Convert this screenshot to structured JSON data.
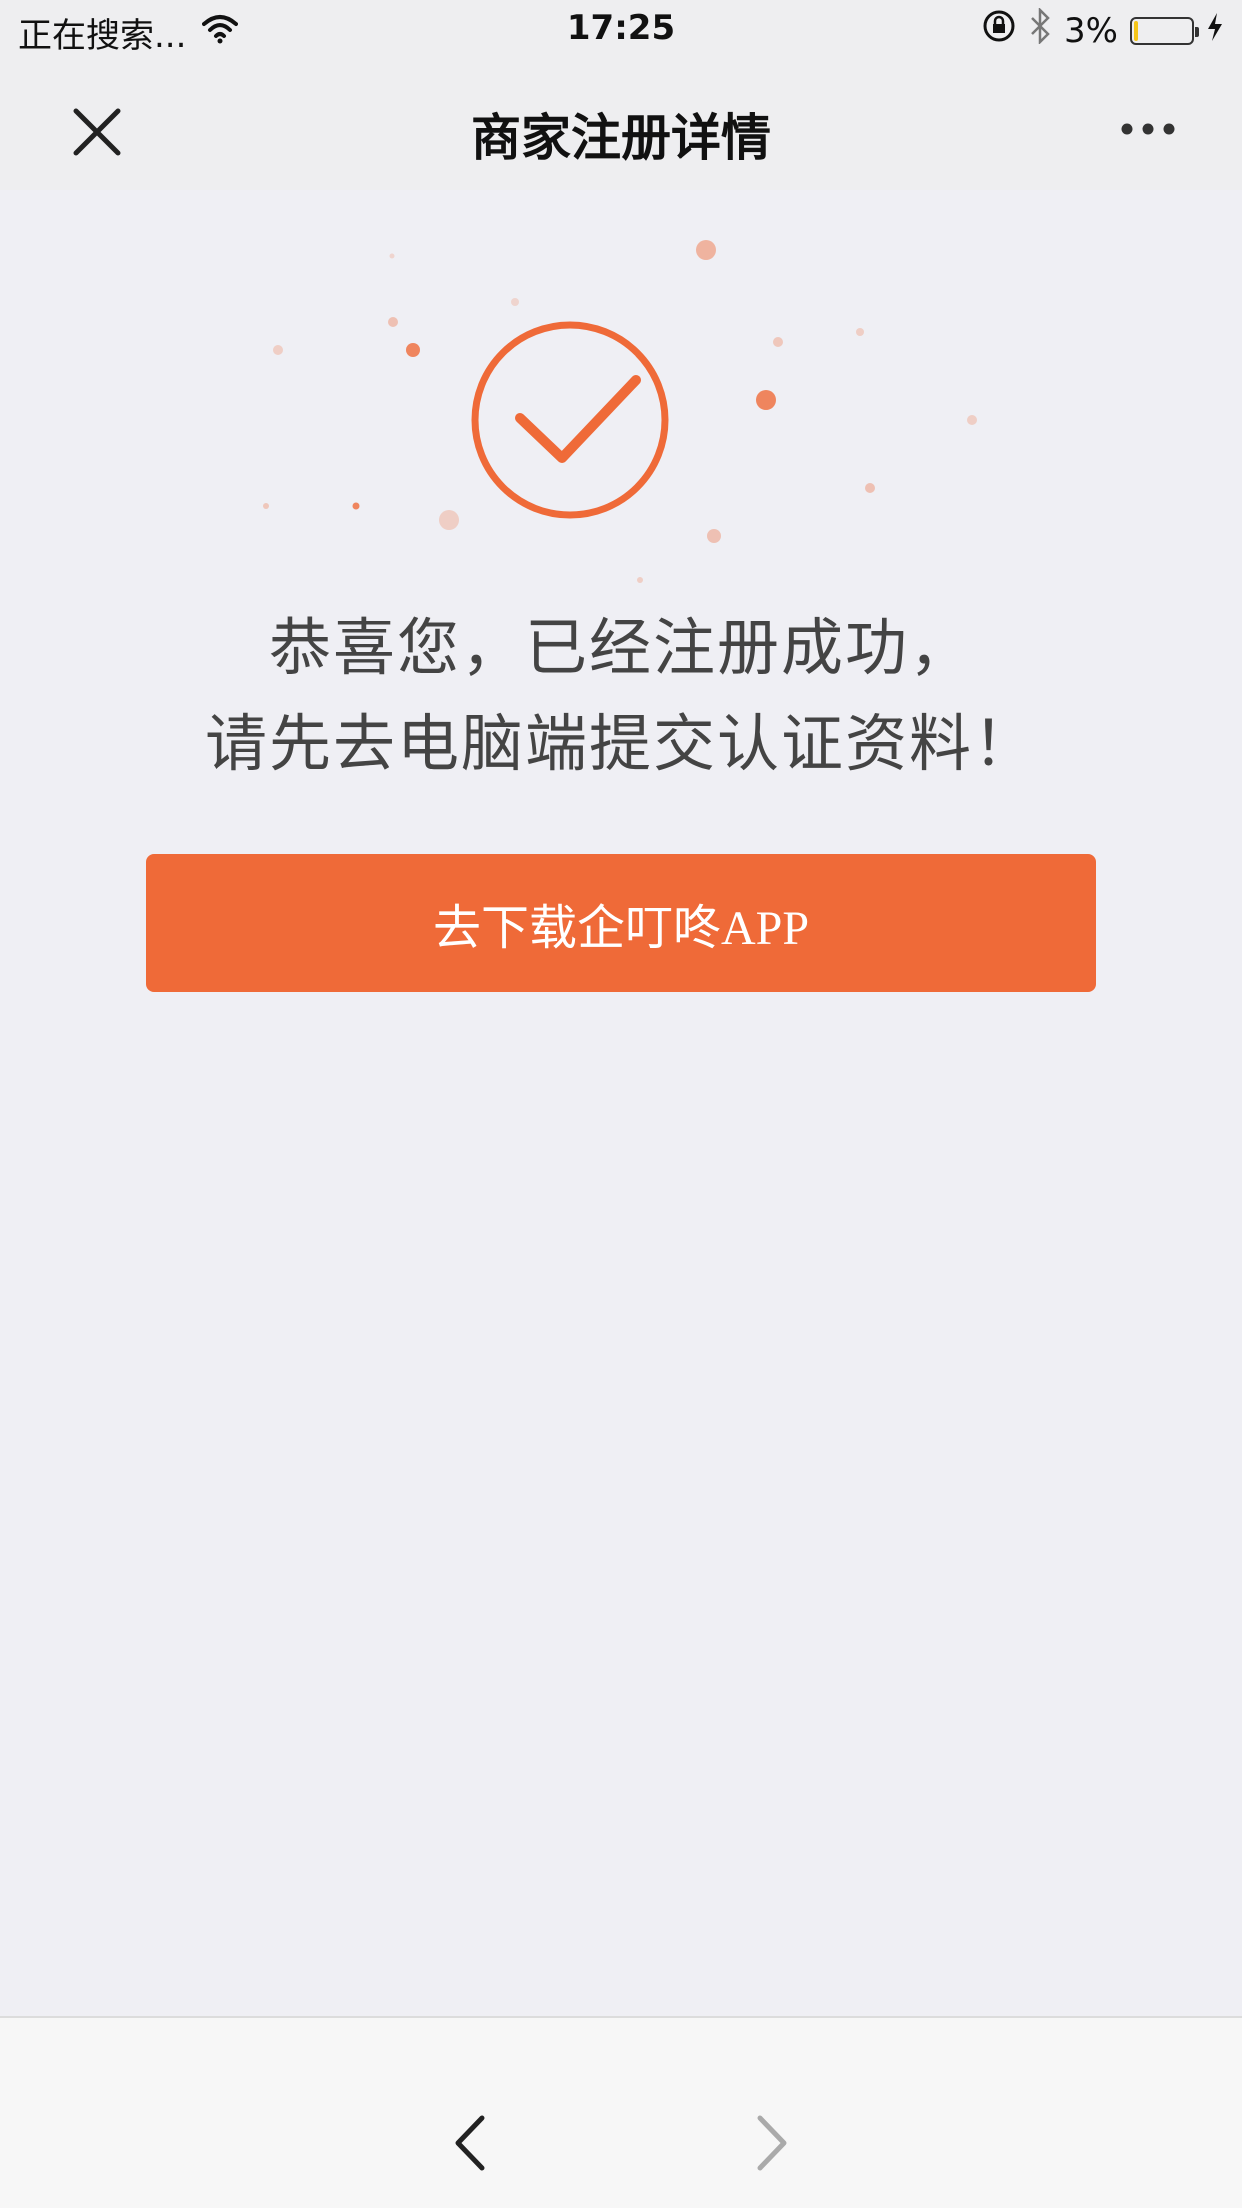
{
  "status_bar": {
    "carrier": "正在搜索...",
    "time": "17:25",
    "battery_percent": "3%"
  },
  "nav": {
    "title": "商家注册详情",
    "close_icon": "close-icon",
    "more_icon": "more-icon"
  },
  "content": {
    "icon": "success-check-icon",
    "message_line1": "恭喜您，已经注册成功，",
    "message_line2": "请先去电脑端提交认证资料！",
    "cta_label": "去下载企叮咚APP"
  },
  "bottom_bar": {
    "back_icon": "chevron-left-icon",
    "forward_icon": "chevron-right-icon"
  },
  "colors": {
    "accent": "#ef6a38",
    "background": "#efeff4"
  }
}
